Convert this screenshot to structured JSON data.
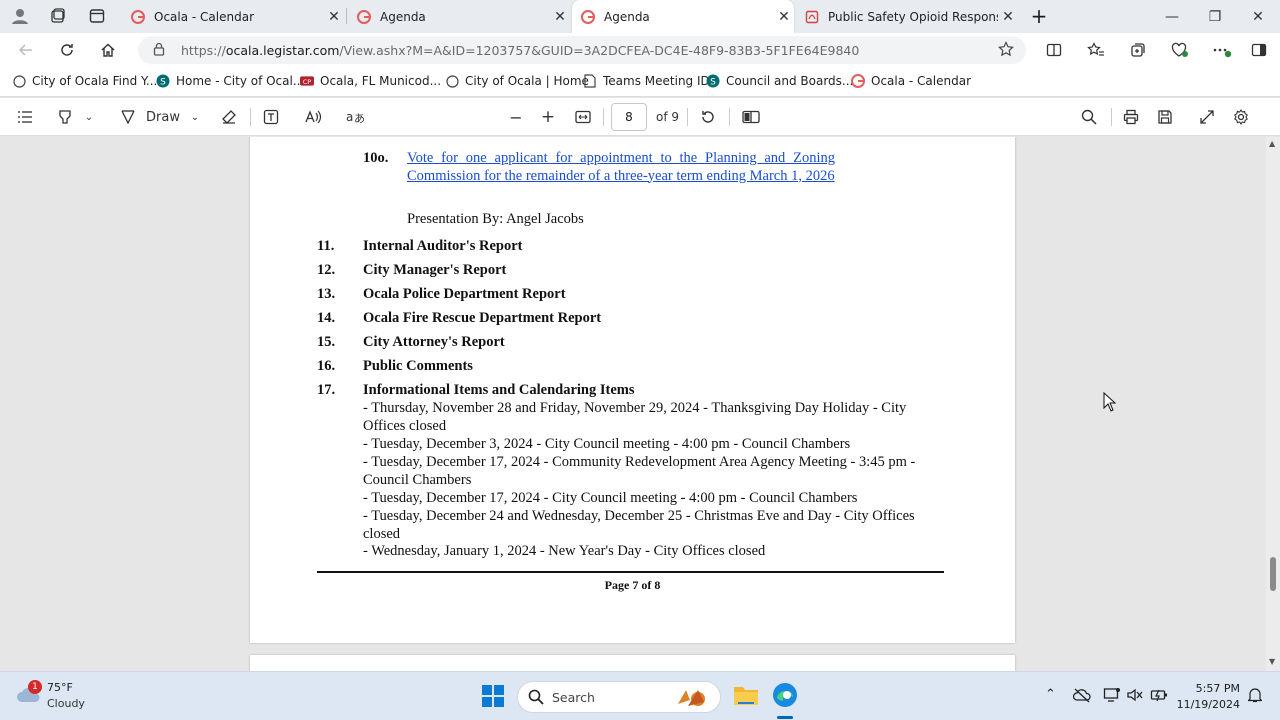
{
  "tabs": [
    {
      "title": "Ocala - Calendar",
      "active": false
    },
    {
      "title": "Agenda",
      "active": false
    },
    {
      "title": "Agenda",
      "active": true
    },
    {
      "title": "Public Safety Opioid Response Eff",
      "active": false
    }
  ],
  "address": {
    "scheme": "https://",
    "domain": "ocala.legistar.com",
    "path": "/View.ashx?M=A&ID=1203757&GUID=3A2DCFEA-DC4E-48F9-83B3-5F1FE64E9840"
  },
  "favorites": [
    {
      "label": "City of Ocala  Find Y..."
    },
    {
      "label": "Home - City of Ocal..."
    },
    {
      "label": "Ocala, FL  Municod..."
    },
    {
      "label": "City of Ocala | Home"
    },
    {
      "label": "Teams Meeting ID"
    },
    {
      "label": "Council and Boards..."
    },
    {
      "label": "Ocala - Calendar"
    }
  ],
  "pdf_toolbar": {
    "draw_label": "Draw",
    "current_page": "8",
    "total_pages": "of 9"
  },
  "document": {
    "item_10o": {
      "number": "10o.",
      "text": "Vote for one applicant for appointment to the Planning and Zoning Commission for the remainder of a three-year term ending March 1, 2026",
      "presenter": "Presentation By: Angel Jacobs"
    },
    "items": [
      {
        "number": "11.",
        "title": "Internal Auditor's Report"
      },
      {
        "number": "12.",
        "title": "City Manager's Report"
      },
      {
        "number": "13.",
        "title": "Ocala Police Department Report"
      },
      {
        "number": "14.",
        "title": "Ocala Fire Rescue Department Report"
      },
      {
        "number": "15.",
        "title": "City Attorney's Report"
      },
      {
        "number": "16.",
        "title": "Public Comments"
      },
      {
        "number": "17.",
        "title": "Informational Items and Calendaring Items"
      }
    ],
    "info_lines": [
      "- Thursday, November 28 and Friday, November 29, 2024 - Thanksgiving Day Holiday - City",
      "Offices closed",
      "- Tuesday, December 3, 2024 - City Council meeting - 4:00 pm - Council Chambers",
      "- Tuesday, December 17, 2024 - Community Redevelopment Area Agency Meeting - 3:45 pm -",
      "Council Chambers",
      "- Tuesday, December 17, 2024 - City Council meeting - 4:00 pm - Council Chambers",
      "- Tuesday, December 24 and Wednesday, December 25 - Christmas Eve and Day - City Offices",
      "closed",
      "- Wednesday, January 1, 2024 - New Year's Day - City Offices closed"
    ],
    "page_footer": "Page 7 of 8"
  },
  "taskbar": {
    "weather_temp": "75°F",
    "weather_desc": "Cloudy",
    "weather_badge": "1",
    "search_placeholder": "Search",
    "time": "5:57 PM",
    "date": "11/19/2024"
  },
  "colors": {
    "link": "#1a4dd6",
    "accent": "#0067c0",
    "tab_active": "#ffffff"
  }
}
